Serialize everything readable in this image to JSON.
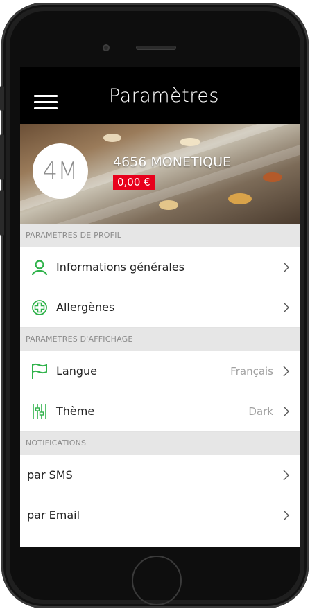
{
  "header": {
    "title": "Paramètres",
    "menu_icon": "hamburger-menu-icon"
  },
  "profile": {
    "avatar_initials": "4M",
    "name": "4656 MONETIQUE",
    "balance": "0,00 €",
    "balance_color": "#e8001c"
  },
  "sections": {
    "profile": {
      "title": "PARAMÈTRES DE PROFIL",
      "items": [
        {
          "label": "Informations générales",
          "icon": "user-icon"
        },
        {
          "label": "Allergènes",
          "icon": "allergen-plus-icon"
        }
      ]
    },
    "display": {
      "title": "PARAMÈTRES D'AFFICHAGE",
      "items": [
        {
          "label": "Langue",
          "value": "Français",
          "icon": "flag-icon"
        },
        {
          "label": "Thème",
          "value": "Dark",
          "icon": "sliders-icon"
        }
      ]
    },
    "notifications": {
      "title": "NOTIFICATIONS",
      "items": [
        {
          "label": "par SMS"
        },
        {
          "label": "par Email"
        }
      ]
    }
  },
  "colors": {
    "accent": "#2fb24a",
    "header_bg": "#000000"
  }
}
